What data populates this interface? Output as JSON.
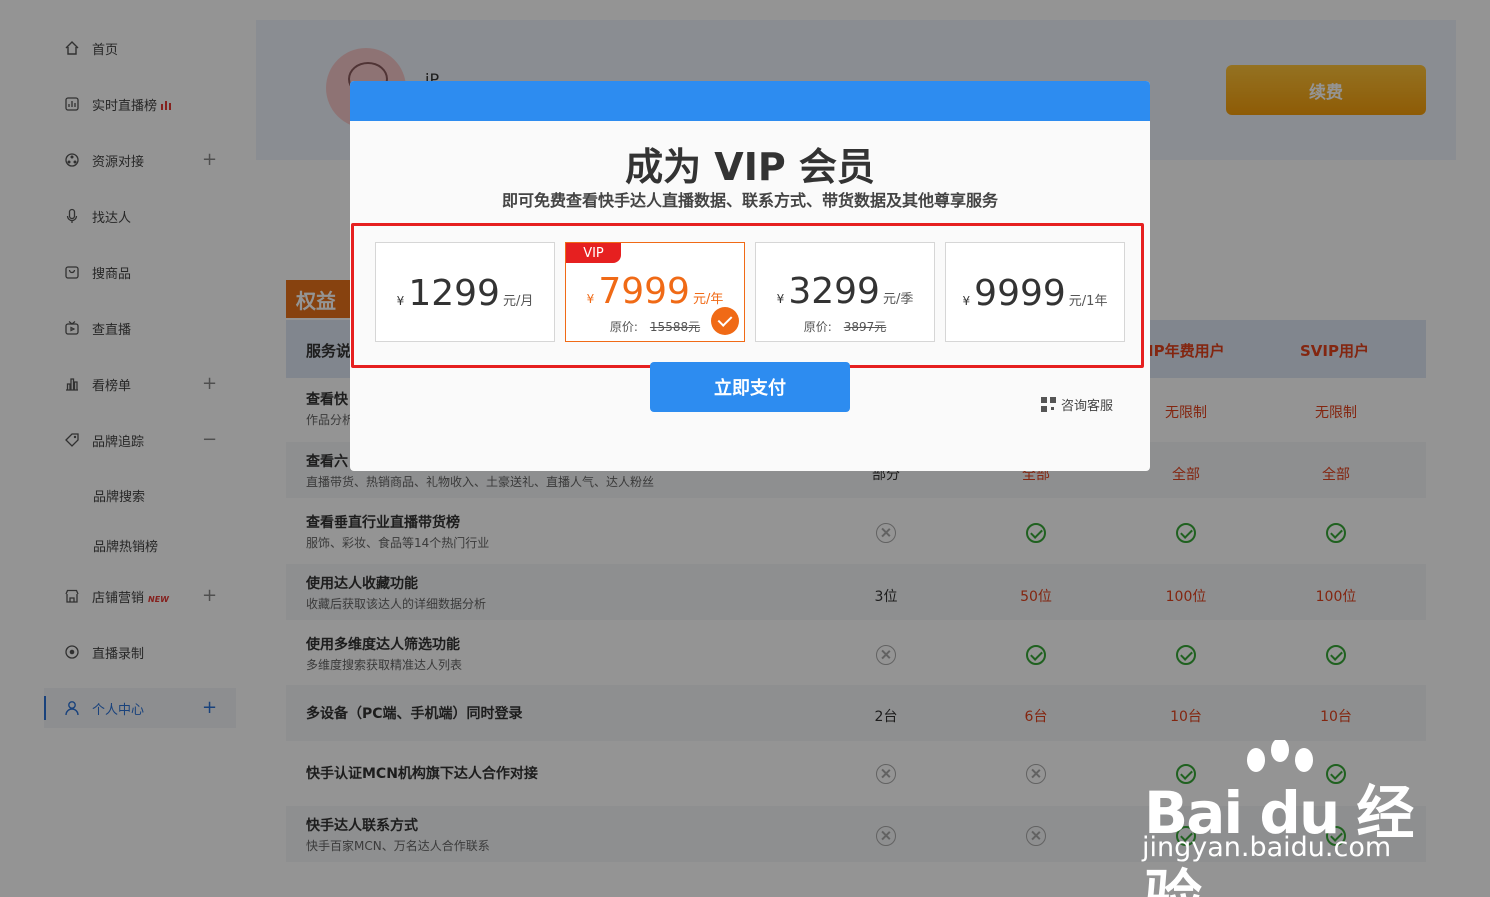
{
  "sidebar": {
    "items": [
      {
        "label": "首页",
        "icon": "home-icon"
      },
      {
        "label": "实时直播榜",
        "icon": "chart-icon"
      },
      {
        "label": "资源对接",
        "icon": "network-icon"
      },
      {
        "label": "找达人",
        "icon": "microphone-icon"
      },
      {
        "label": "搜商品",
        "icon": "bag-icon"
      },
      {
        "label": "查直播",
        "icon": "tv-icon"
      },
      {
        "label": "看榜单",
        "icon": "bar-chart-icon"
      },
      {
        "label": "品牌追踪",
        "icon": "tag-icon"
      },
      {
        "label": "品牌搜索"
      },
      {
        "label": "品牌热销榜"
      },
      {
        "label": "店铺营销",
        "icon": "store-icon",
        "badge": "NEW"
      },
      {
        "label": "直播录制",
        "icon": "record-icon"
      },
      {
        "label": "个人中心",
        "icon": "user-icon"
      }
    ]
  },
  "profile": {
    "username": "iP",
    "renew_label": "续费"
  },
  "benefits": {
    "tag": "权益",
    "headers": [
      "服务说",
      "IP年费用户",
      "SVIP用户"
    ],
    "rows": [
      {
        "title": "查看快",
        "desc": "作品分析",
        "values": [
          "",
          "",
          "无限制",
          "无限制"
        ]
      },
      {
        "title": "查看六",
        "desc": "直播带货、热销商品、礼物收入、土豪送礼、直播人气、达人粉丝",
        "values": [
          "部分",
          "全部",
          "全部",
          "全部"
        ]
      },
      {
        "title": "查看垂直行业直播带货榜",
        "desc": "服饰、彩妆、食品等14个热门行业",
        "values": [
          "no",
          "ok",
          "ok",
          "ok"
        ]
      },
      {
        "title": "使用达人收藏功能",
        "desc": "收藏后获取该达人的详细数据分析",
        "values": [
          "3位",
          "50位",
          "100位",
          "100位"
        ]
      },
      {
        "title": "使用多维度达人筛选功能",
        "desc": "多维度搜索获取精准达人列表",
        "values": [
          "no",
          "ok",
          "ok",
          "ok"
        ]
      },
      {
        "title": "多设备（PC端、手机端）同时登录",
        "desc": "",
        "values": [
          "2台",
          "6台",
          "10台",
          "10台"
        ]
      },
      {
        "title": "快手认证MCN机构旗下达人合作对接",
        "desc": "",
        "values": [
          "no",
          "no",
          "ok",
          "ok"
        ]
      },
      {
        "title": "快手达人联系方式",
        "desc": "快手百家MCN、万名达人合作联系",
        "values": [
          "no",
          "no",
          "ok",
          "ok"
        ]
      }
    ]
  },
  "modal": {
    "title": "成为 VIP 会员",
    "subtitle": "即可免费查看快手达人直播数据、联系方式、带货数据及其他尊享服务",
    "plans": [
      {
        "currency": "¥",
        "amount": "1299",
        "unit": "元/月",
        "orig_label": "",
        "orig_price": ""
      },
      {
        "currency": "¥",
        "amount": "7999",
        "unit": "元/年",
        "orig_label": "原价:",
        "orig_price": "15588元",
        "tag": "VIP"
      },
      {
        "currency": "¥",
        "amount": "3299",
        "unit": "元/季",
        "orig_label": "原价:",
        "orig_price": "3897元"
      },
      {
        "currency": "¥",
        "amount": "9999",
        "unit": "元/1年",
        "orig_label": "",
        "orig_price": ""
      }
    ],
    "pay_label": "立即支付",
    "consult_label": "咨询客服"
  },
  "watermark": {
    "logo": "Bai du 经验",
    "url": "jingyan.baidu.com"
  },
  "colors": {
    "accent": "#2d8cf0",
    "selected": "#f06a16",
    "highlight_frame": "#e62020",
    "gold": "#f5a623"
  }
}
